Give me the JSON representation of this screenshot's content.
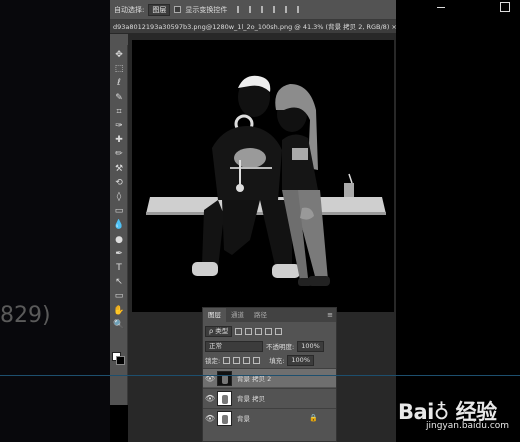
{
  "outside": {
    "left_number": "829)"
  },
  "options_bar": {
    "auto_select_label": "自动选择:",
    "auto_select_value": "图层",
    "show_transform_label": "显示变换控件"
  },
  "document_tab": {
    "title": "d93a8012193a30597b3.png@1280w_1l_2o_100sh.png @ 41.3% (背景 拷贝 2, RGB/8) ×"
  },
  "toolbar": {
    "tools": [
      "move-tool",
      "marquee-tool",
      "lasso-tool",
      "quick-select-tool",
      "crop-tool",
      "eyedropper-tool",
      "healing-brush-tool",
      "brush-tool",
      "clone-stamp-tool",
      "history-brush-tool",
      "eraser-tool",
      "gradient-tool",
      "blur-tool",
      "dodge-tool",
      "pen-tool",
      "type-tool",
      "path-select-tool",
      "shape-tool",
      "hand-tool",
      "zoom-tool"
    ],
    "icons": [
      "✥",
      "⬚",
      "ℓ",
      "✎",
      "⌗",
      "✑",
      "✚",
      "✏",
      "⚒",
      "⟲",
      "◊",
      "▭",
      "💧",
      "●",
      "✒",
      "T",
      "↖",
      "▭",
      "✋",
      "🔍"
    ]
  },
  "layers_panel": {
    "tabs": [
      "图层",
      "通道",
      "路径"
    ],
    "menu_icon": "≡",
    "kind_label": "ρ 类型",
    "blend_mode": "正常",
    "opacity_label": "不透明度:",
    "opacity_value": "100%",
    "lock_label": "锁定:",
    "fill_label": "填充:",
    "fill_value": "100%",
    "layers": [
      {
        "name": "背景 拷贝 2",
        "active": true,
        "locked": false
      },
      {
        "name": "背景 拷贝",
        "active": false,
        "locked": false
      },
      {
        "name": "背景",
        "active": false,
        "locked": true
      }
    ]
  },
  "watermark": {
    "logo": "Bai♁ 经验",
    "url": "jingyan.baidu.com"
  },
  "colors": {
    "ps_panel": "#535353",
    "ps_dark": "#282828",
    "canvas": "#000000",
    "accent_line": "#1d4f6e"
  }
}
